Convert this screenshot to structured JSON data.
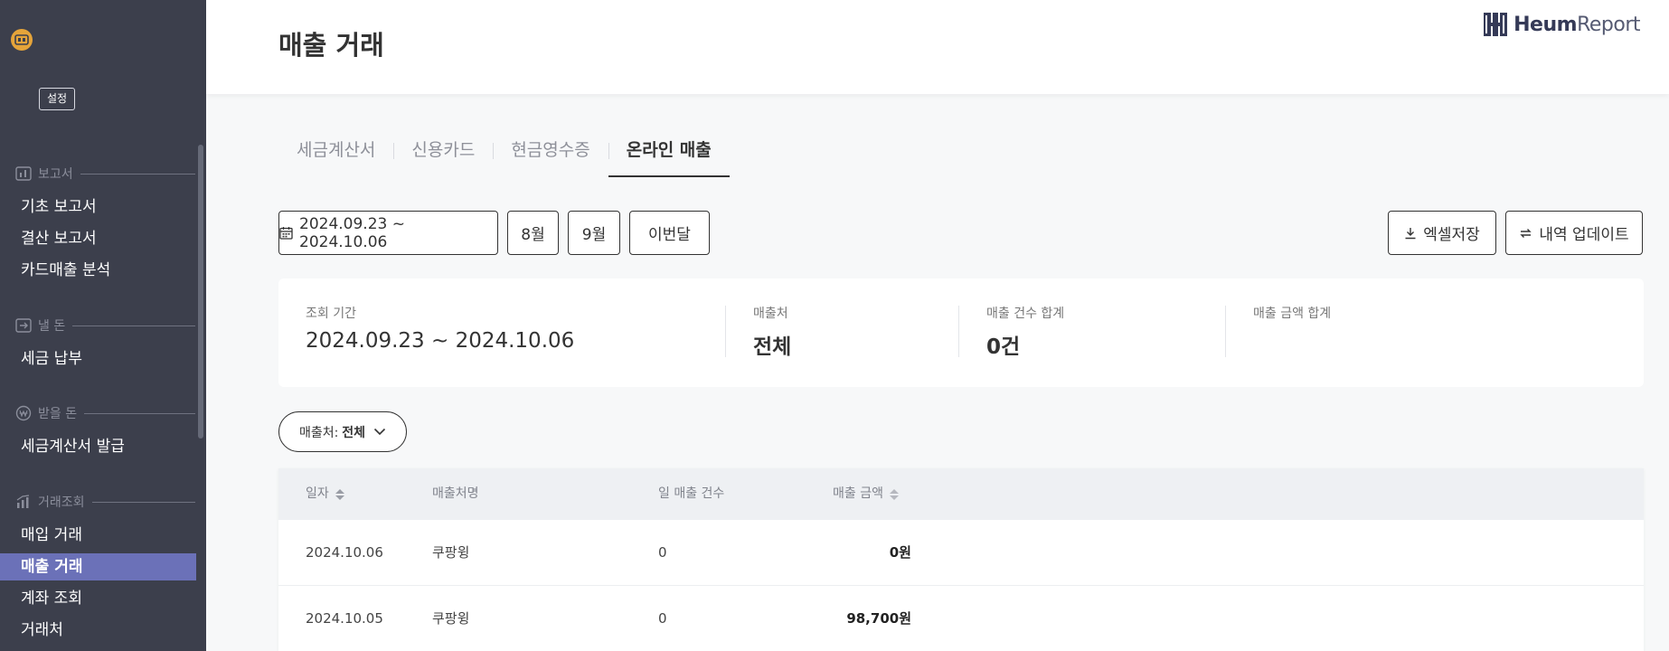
{
  "sidebar": {
    "settings_label": "설정",
    "sections": [
      {
        "label": "보고서",
        "icon": "report-chart-icon"
      },
      {
        "label": "낼 돈",
        "icon": "outgoing-money-icon"
      },
      {
        "label": "받을 돈",
        "icon": "won-coin-icon"
      },
      {
        "label": "거래조회",
        "icon": "transaction-chart-icon"
      }
    ],
    "items": [
      {
        "label": "기초 보고서"
      },
      {
        "label": "결산 보고서"
      },
      {
        "label": "카드매출 분석"
      },
      {
        "label": "세금 납부"
      },
      {
        "label": "세금계산서 발급"
      },
      {
        "label": "매입 거래"
      },
      {
        "label": "매출 거래",
        "active": true
      },
      {
        "label": "계좌 조회"
      },
      {
        "label": "거래처"
      }
    ]
  },
  "header": {
    "title": "매출 거래",
    "brand_bold": "Heum",
    "brand_light": "Report"
  },
  "tabs": [
    {
      "label": "세금계산서"
    },
    {
      "label": "신용카드"
    },
    {
      "label": "현금영수증"
    },
    {
      "label": "온라인 매출",
      "active": true
    }
  ],
  "filters": {
    "date_range": "2024.09.23 ~ 2024.10.06",
    "month_aug": "8월",
    "month_sep": "9월",
    "this_month": "이번달",
    "excel_save": "엑셀저장",
    "update_history": "내역 업데이트"
  },
  "summary": {
    "period_label": "조회 기간",
    "period_value": "2024.09.23 ~ 2024.10.06",
    "vendor_label": "매출처",
    "vendor_value": "전체",
    "count_label": "매출 건수 합계",
    "count_value": "0건",
    "amount_label": "매출 금액 합계",
    "amount_value": ""
  },
  "vendor_filter": {
    "prefix": "매출처:",
    "value": "전체"
  },
  "table": {
    "headers": {
      "date": "일자",
      "vendor": "매출처명",
      "daily_count": "일 매출 건수",
      "amount": "매출 금액"
    },
    "rows": [
      {
        "date": "2024.10.06",
        "vendor": "쿠팡윙",
        "count": "0",
        "amount": "0원"
      },
      {
        "date": "2024.10.05",
        "vendor": "쿠팡윙",
        "count": "0",
        "amount": "98,700원"
      }
    ]
  },
  "colors": {
    "sidebar_bg": "#3c3f4c",
    "sidebar_active": "#6b71b8",
    "logo_badge": "#e5a43a",
    "brand_navy": "#353a57"
  }
}
